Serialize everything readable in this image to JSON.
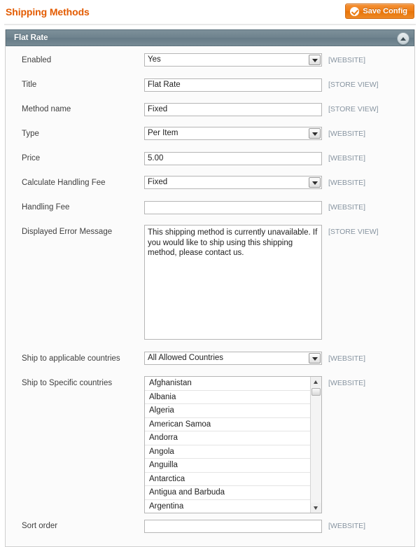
{
  "header": {
    "title": "Shipping Methods",
    "save_label": "Save Config",
    "save_icon": "check-circle-icon"
  },
  "panel": {
    "title": "Flat Rate",
    "collapse_icon": "chevron-up-icon"
  },
  "scopes": {
    "website": "[WEBSITE]",
    "store_view": "[STORE VIEW]"
  },
  "fields": {
    "enabled": {
      "label": "Enabled",
      "value": "Yes",
      "scope": "[WEBSITE]"
    },
    "title": {
      "label": "Title",
      "value": "Flat Rate",
      "scope": "[STORE VIEW]"
    },
    "method_name": {
      "label": "Method name",
      "value": "Fixed",
      "scope": "[STORE VIEW]"
    },
    "type": {
      "label": "Type",
      "value": "Per Item",
      "scope": "[WEBSITE]"
    },
    "price": {
      "label": "Price",
      "value": "5.00",
      "scope": "[WEBSITE]"
    },
    "calculate_handling_fee": {
      "label": "Calculate Handling Fee",
      "value": "Fixed",
      "scope": "[WEBSITE]"
    },
    "handling_fee": {
      "label": "Handling Fee",
      "value": "",
      "scope": "[WEBSITE]"
    },
    "displayed_error_message": {
      "label": "Displayed Error Message",
      "value": "This shipping method is currently unavailable. If you would like to ship using this shipping method, please contact us.",
      "scope": "[STORE VIEW]"
    },
    "ship_to_applicable_countries": {
      "label": "Ship to applicable countries",
      "value": "All Allowed Countries",
      "scope": "[WEBSITE]"
    },
    "ship_to_specific_countries": {
      "label": "Ship to Specific countries",
      "scope": "[WEBSITE]",
      "options": [
        "Afghanistan",
        "Albania",
        "Algeria",
        "American Samoa",
        "Andorra",
        "Angola",
        "Anguilla",
        "Antarctica",
        "Antigua and Barbuda",
        "Argentina"
      ]
    },
    "sort_order": {
      "label": "Sort order",
      "value": "",
      "scope": "[WEBSITE]"
    }
  },
  "colors": {
    "title_orange": "#e35b00",
    "panel_header": "#6e828d",
    "scope_label": "#8794a0"
  }
}
